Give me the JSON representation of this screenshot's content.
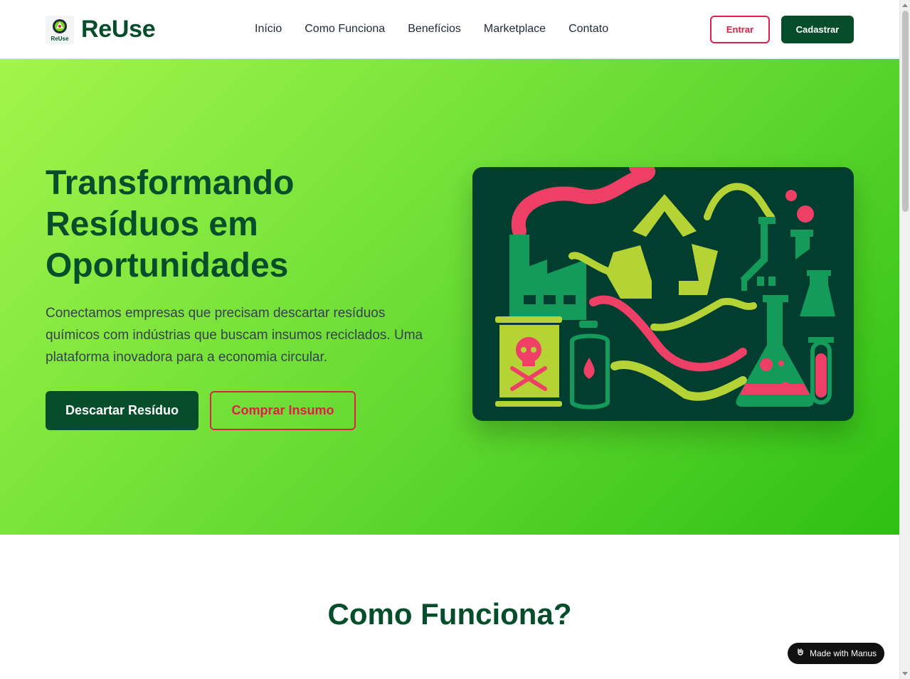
{
  "header": {
    "logo_caption": "ReUse",
    "brand": "ReUse",
    "nav": [
      "Início",
      "Como Funciona",
      "Benefícios",
      "Marketplace",
      "Contato"
    ],
    "login_label": "Entrar",
    "signup_label": "Cadastrar"
  },
  "hero": {
    "title": "Transformando Resíduos em Oportunidades",
    "description": "Conectamos empresas que precisam descartar resíduos químicos com indústrias que buscam insumos reciclados. Uma plataforma inovadora para a economia circular.",
    "primary_button": "Descartar Resíduo",
    "secondary_button": "Comprar Insumo"
  },
  "section": {
    "title": "Como Funciona?"
  },
  "badge": {
    "label": "Made with Manus"
  },
  "colors": {
    "brand_dark_green": "#064e2b",
    "accent_red": "#e11d48",
    "hero_gradient_start": "#a3f54a",
    "hero_gradient_end": "#2ebf14",
    "illustration_bg": "#023e30"
  }
}
